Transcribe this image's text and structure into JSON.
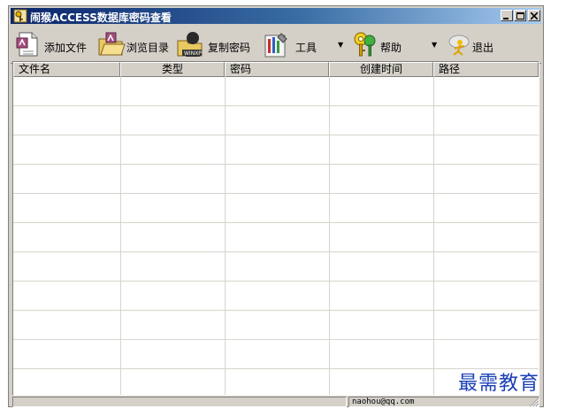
{
  "window": {
    "title": "闹猴ACCESS数据库密码查看"
  },
  "toolbar": {
    "buttons": [
      {
        "label": "添加文件",
        "icon": "add-file-icon"
      },
      {
        "label": "浏览目录",
        "icon": "browse-folder-icon"
      },
      {
        "label": "复制密码",
        "icon": "copy-password-icon"
      },
      {
        "label": "工具",
        "icon": "tools-icon"
      },
      {
        "label": "帮助",
        "icon": "help-keys-icon"
      },
      {
        "label": "退出",
        "icon": "exit-icon"
      }
    ],
    "dropdown_arrow": "▼"
  },
  "table": {
    "columns": [
      "文件名",
      "类型",
      "密码",
      "创建时间",
      "路径"
    ],
    "rows": []
  },
  "statusbar": {
    "left": "",
    "email": "naohou@qq.com"
  },
  "watermark": "最需教育",
  "colors": {
    "title_gradient_start": "#0a246a",
    "title_gradient_end": "#a6caf0",
    "face": "#d4d0c8",
    "watermark": "#1a3fb5"
  }
}
